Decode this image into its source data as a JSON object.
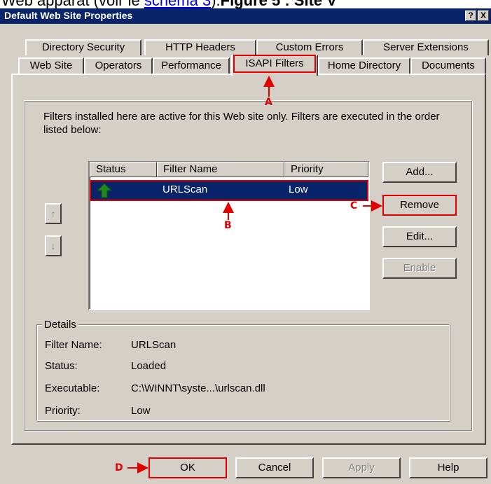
{
  "top_strip": {
    "prefix": "Web apparat (voir le ",
    "link": "schéma 3",
    "suffix": ").",
    "figure": "Figure 5 : Site V"
  },
  "window": {
    "title": "Default Web Site Properties",
    "help_btn": "?",
    "close_btn": "X"
  },
  "tabs_back": [
    "Directory Security",
    "HTTP Headers",
    "Custom Errors",
    "Server Extensions"
  ],
  "tabs_front": [
    "Web Site",
    "Operators",
    "Performance",
    "ISAPI Filters",
    "Home Directory",
    "Documents"
  ],
  "active_tab": "ISAPI Filters",
  "description": "Filters installed here are active for this Web site only. Filters are executed in the order listed below:",
  "list": {
    "headers": [
      "Status",
      "Filter Name",
      "Priority"
    ],
    "rows": [
      {
        "status_icon": "green-up-arrow-icon",
        "name": "URLScan",
        "priority": "Low"
      }
    ]
  },
  "move_buttons": {
    "up": "↑",
    "down": "↓"
  },
  "side_buttons": {
    "add": "Add...",
    "remove": "Remove",
    "edit": "Edit...",
    "enable": "Enable"
  },
  "details": {
    "legend": "Details",
    "labels": {
      "name": "Filter Name:",
      "status": "Status:",
      "exe": "Executable:",
      "priority": "Priority:"
    },
    "values": {
      "name": "URLScan",
      "status": "Loaded",
      "exe": "C:\\WINNT\\syste...\\urlscan.dll",
      "priority": "Low"
    }
  },
  "bottom_buttons": {
    "ok": "OK",
    "cancel": "Cancel",
    "apply": "Apply",
    "help": "Help"
  },
  "annotations": {
    "a": "A",
    "b": "B",
    "c": "C",
    "d": "D"
  },
  "colors": {
    "titlebar": "#0a246a",
    "dialog": "#d4d0c8",
    "selection": "#0a246a",
    "annotation": "#e00000",
    "status_icon": "#1e8a1e"
  }
}
